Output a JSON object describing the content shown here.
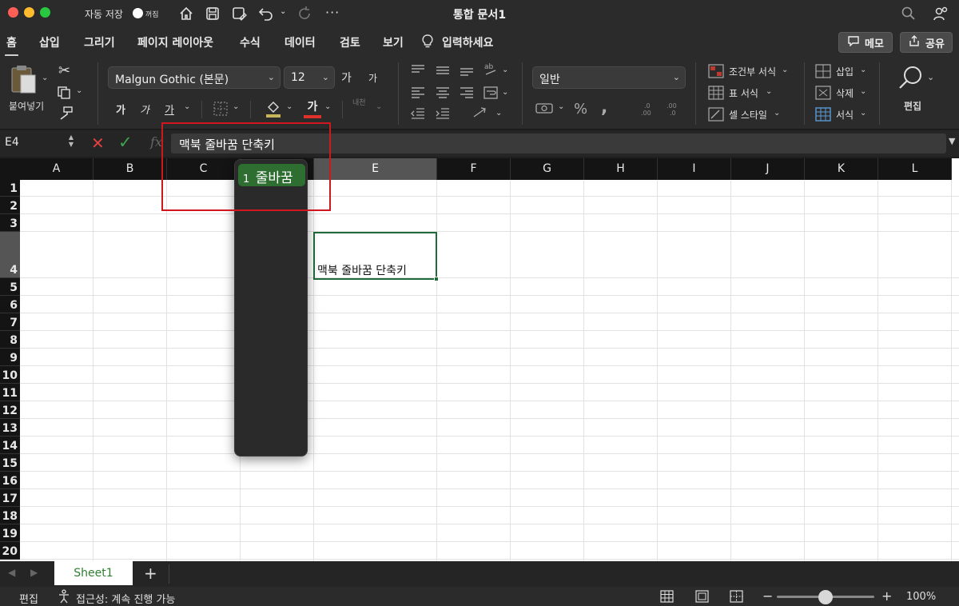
{
  "titlebar": {
    "autosave_label": "자동 저장",
    "autosave_state": "꺼짐",
    "doc_title": "통합 문서1"
  },
  "ribbon_tabs": [
    {
      "label": "홈",
      "active": true
    },
    {
      "label": "삽입"
    },
    {
      "label": "그리기"
    },
    {
      "label": "페이지 레이아웃"
    },
    {
      "label": "수식"
    },
    {
      "label": "데이터"
    },
    {
      "label": "검토"
    },
    {
      "label": "보기"
    }
  ],
  "tell_me": "입력하세요",
  "comments_button": "메모",
  "share_button": "공유",
  "ribbon": {
    "paste_label": "붙여넣기",
    "font_name": "Malgun Gothic (본문)",
    "font_size": "12",
    "grow_font": "가",
    "shrink_font": "가",
    "bold": "가",
    "italic": "가",
    "underline": "가",
    "font_color_glyph": "가",
    "phonetic": "내천",
    "number_format": "일반",
    "percent": "%",
    "comma": ",",
    "conditional_format": "조건부 서식",
    "format_as_table": "표 서식",
    "cell_styles": "셀 스타일",
    "insert": "삽입",
    "delete": "삭제",
    "format": "서식",
    "editing": "편집",
    "font_color": "#e0302a",
    "fill_color": "#c9b458"
  },
  "formula_bar": {
    "name_box": "E4",
    "fx": "fx",
    "content": "맥북 줄바꿈 단축키"
  },
  "columns": [
    "A",
    "B",
    "C",
    "D",
    "E",
    "F",
    "G",
    "H",
    "I",
    "J",
    "K",
    "L"
  ],
  "rows": [
    "1",
    "2",
    "3",
    "4",
    "5",
    "6",
    "7",
    "8",
    "9",
    "10",
    "11",
    "12",
    "13",
    "14",
    "15",
    "16",
    "17",
    "18",
    "19",
    "20"
  ],
  "active_cell": {
    "ref": "E4",
    "value": "맥북 줄바꿈 단축키"
  },
  "autocomplete_popup": {
    "items": [
      {
        "num": "1",
        "label": "줄바꿈"
      }
    ]
  },
  "sheets": [
    {
      "name": "Sheet1",
      "active": true
    }
  ],
  "status_bar": {
    "mode": "편집",
    "accessibility": "접근성: 계속 진행 가능",
    "zoom": "100%",
    "zoom_minus": "−",
    "zoom_plus": "+"
  }
}
